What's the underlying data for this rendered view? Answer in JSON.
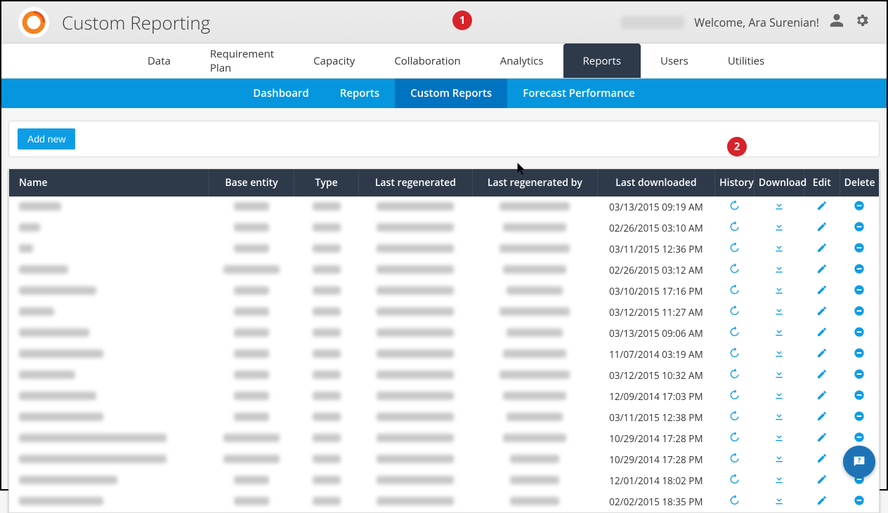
{
  "header": {
    "title": "Custom Reporting",
    "welcome": "Welcome, Ara Surenian!"
  },
  "callouts": {
    "one": "1",
    "two": "2"
  },
  "nav": {
    "items": [
      "Data",
      "Requirement Plan",
      "Capacity",
      "Collaboration",
      "Analytics",
      "Reports",
      "Users",
      "Utilities"
    ],
    "active": "Reports"
  },
  "subnav": {
    "items": [
      "Dashboard",
      "Reports",
      "Custom Reports",
      "Forecast Performance"
    ],
    "active": "Custom Reports"
  },
  "toolbar": {
    "add_new": "Add new"
  },
  "table": {
    "headers": {
      "name": "Name",
      "entity": "Base entity",
      "type": "Type",
      "regen": "Last regenerated",
      "regenby": "Last regenerated by",
      "dl": "Last downloaded",
      "history": "History",
      "download": "Download",
      "edit": "Edit",
      "del": "Delete"
    },
    "rows": [
      {
        "downloaded": "03/13/2015 09:19 AM",
        "name_w": 60,
        "entity_w": 50,
        "type_w": 40,
        "regen_w": 110,
        "regenby_w": 100
      },
      {
        "downloaded": "02/26/2015 03:10 AM",
        "name_w": 30,
        "entity_w": 50,
        "type_w": 40,
        "regen_w": 110,
        "regenby_w": 90
      },
      {
        "downloaded": "03/11/2015 12:36 PM",
        "name_w": 20,
        "entity_w": 50,
        "type_w": 40,
        "regen_w": 110,
        "regenby_w": 100
      },
      {
        "downloaded": "02/26/2015 03:12 AM",
        "name_w": 70,
        "entity_w": 80,
        "type_w": 40,
        "regen_w": 110,
        "regenby_w": 90
      },
      {
        "downloaded": "03/10/2015 17:16 PM",
        "name_w": 110,
        "entity_w": 50,
        "type_w": 40,
        "regen_w": 110,
        "regenby_w": 80
      },
      {
        "downloaded": "03/12/2015 11:27 AM",
        "name_w": 50,
        "entity_w": 50,
        "type_w": 40,
        "regen_w": 110,
        "regenby_w": 100
      },
      {
        "downloaded": "03/13/2015 09:06 AM",
        "name_w": 100,
        "entity_w": 50,
        "type_w": 40,
        "regen_w": 110,
        "regenby_w": 80
      },
      {
        "downloaded": "11/07/2014 03:19 AM",
        "name_w": 120,
        "entity_w": 50,
        "type_w": 40,
        "regen_w": 110,
        "regenby_w": 90
      },
      {
        "downloaded": "03/12/2015 10:32 AM",
        "name_w": 80,
        "entity_w": 50,
        "type_w": 40,
        "regen_w": 110,
        "regenby_w": 100
      },
      {
        "downloaded": "12/09/2014 17:03 PM",
        "name_w": 110,
        "entity_w": 50,
        "type_w": 40,
        "regen_w": 110,
        "regenby_w": 90
      },
      {
        "downloaded": "03/11/2015 12:38 PM",
        "name_w": 120,
        "entity_w": 50,
        "type_w": 40,
        "regen_w": 110,
        "regenby_w": 80
      },
      {
        "downloaded": "10/29/2014 17:28 PM",
        "name_w": 210,
        "entity_w": 80,
        "type_w": 40,
        "regen_w": 110,
        "regenby_w": 90
      },
      {
        "downloaded": "10/29/2014 17:28 PM",
        "name_w": 210,
        "entity_w": 80,
        "type_w": 40,
        "regen_w": 110,
        "regenby_w": 70
      },
      {
        "downloaded": "12/01/2014 18:02 PM",
        "name_w": 140,
        "entity_w": 50,
        "type_w": 40,
        "regen_w": 110,
        "regenby_w": 70
      },
      {
        "downloaded": "02/02/2015 18:35 PM",
        "name_w": 120,
        "entity_w": 50,
        "type_w": 40,
        "regen_w": 110,
        "regenby_w": 70
      }
    ]
  }
}
